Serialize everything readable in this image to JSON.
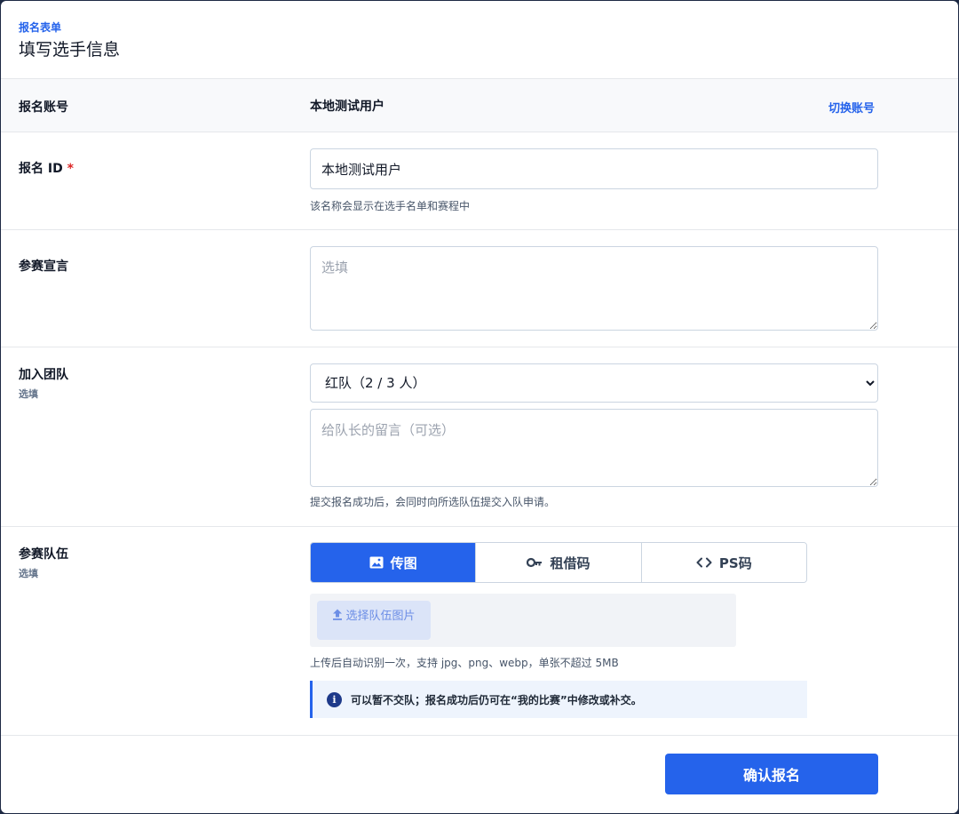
{
  "header": {
    "kicker": "报名表单",
    "title": "填写选手信息"
  },
  "account": {
    "label": "报名账号",
    "value": "本地测试用户",
    "switch_label": "切换账号"
  },
  "registration_id": {
    "label": "报名 ID",
    "required_mark": "*",
    "value": "本地测试用户",
    "hint": "该名称会显示在选手名单和赛程中"
  },
  "declaration": {
    "label": "参赛宣言",
    "placeholder": "选填"
  },
  "team": {
    "label": "加入团队",
    "optional": "选填",
    "selected": "红队（2 / 3 人）",
    "message_placeholder": "给队长的留言（可选）",
    "hint": "提交报名成功后，会同时向所选队伍提交入队申请。"
  },
  "squad": {
    "label": "参赛队伍",
    "optional": "选填",
    "tabs": [
      {
        "label": "传图",
        "icon": "image-icon",
        "active": true
      },
      {
        "label": "租借码",
        "icon": "key-icon",
        "active": false
      },
      {
        "label": "PS码",
        "icon": "code-icon",
        "active": false
      }
    ],
    "upload_label": "选择队伍图片",
    "hint": "上传后自动识别一次，支持 jpg、png、webp，单张不超过 5MB",
    "note": "可以暂不交队；报名成功后仍可在“我的比赛”中修改或补交。"
  },
  "footer": {
    "submit_label": "确认报名"
  },
  "colors": {
    "accent": "#2563eb",
    "required": "#dc2626",
    "note_bg": "#eef4fd"
  }
}
